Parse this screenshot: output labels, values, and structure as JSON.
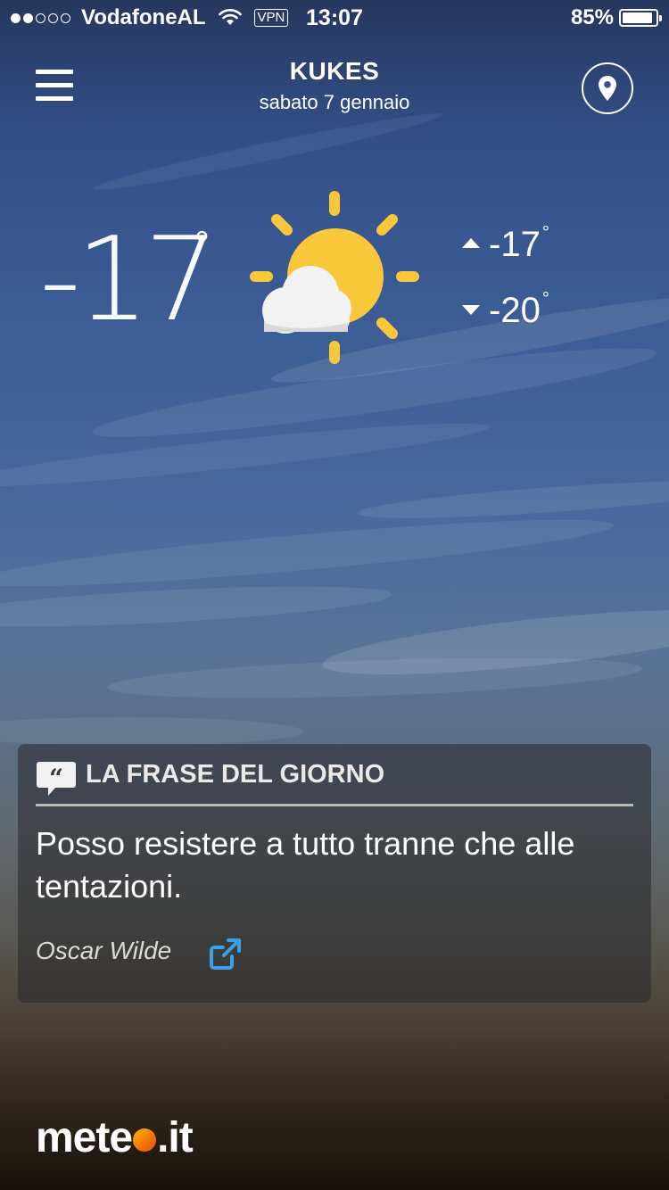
{
  "status_bar": {
    "carrier": "VodafoneAL",
    "signal_full": 2,
    "signal_empty": 3,
    "vpn_label": "VPN",
    "time": "13:07",
    "battery_percent": "85%",
    "battery_level": 0.85
  },
  "header": {
    "city": "KUKES",
    "date": "sabato 7 gennaio",
    "menu_icon": "hamburger-menu-icon",
    "location_icon": "location-pin-icon"
  },
  "current": {
    "temperature": "-17",
    "degree_symbol": "°",
    "condition_icon": "partly-cloudy-sun-icon",
    "max": "-17",
    "min": "-20"
  },
  "quote": {
    "section_title": "LA FRASE DEL GIORNO",
    "icon": "quote-bubble-icon",
    "text": "Posso resistere a tutto tranne che alle tentazioni.",
    "author": "Oscar Wilde",
    "share_icon": "external-link-icon",
    "share_color": "#3aa0e8"
  },
  "brand": {
    "logo_left": "mete",
    "logo_right": ".it",
    "dot_colors": [
      "#ffb300",
      "#e84a10"
    ]
  }
}
